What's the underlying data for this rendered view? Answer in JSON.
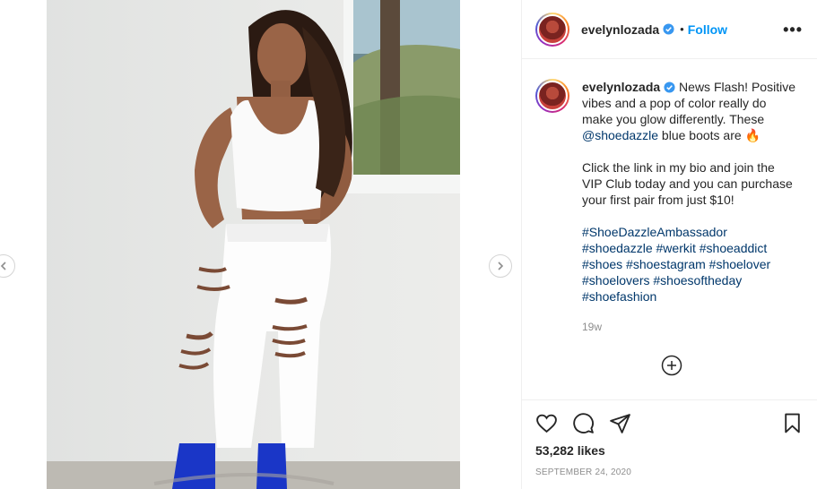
{
  "post": {
    "username": "evelynlozada",
    "follow_label": "Follow",
    "separator": "•",
    "more_label": "•••",
    "caption": {
      "username": "evelynlozada",
      "text_1": " News Flash! Positive vibes and a pop of color really do make you glow differently. These ",
      "mention": "@shoedazzle",
      "text_2": " blue boots are 🔥",
      "paragraph_2": "Click the link in my bio and join the VIP Club today and you can purchase your first pair from just $10!",
      "hashtags": [
        "#ShoeDazzleAmbassador",
        "#shoedazzle",
        "#werkit",
        "#shoeaddict",
        "#shoes",
        "#shoestagram",
        "#shoelover",
        "#shoelovers",
        "#shoesoftheday",
        "#shoefashion"
      ]
    },
    "time_ago": "19w",
    "likes": "53,282 likes",
    "date": "SEPTEMBER 24, 2020"
  },
  "colors": {
    "link": "#00376b",
    "follow": "#0095f6",
    "muted": "#8e8e8e",
    "boots": "#1836c9",
    "jeans": "#ffffff"
  },
  "icons": [
    "chevron-left-icon",
    "chevron-right-icon",
    "verified-badge-icon",
    "more-icon",
    "add-comment-icon",
    "heart-icon",
    "comment-icon",
    "share-icon",
    "bookmark-icon"
  ]
}
